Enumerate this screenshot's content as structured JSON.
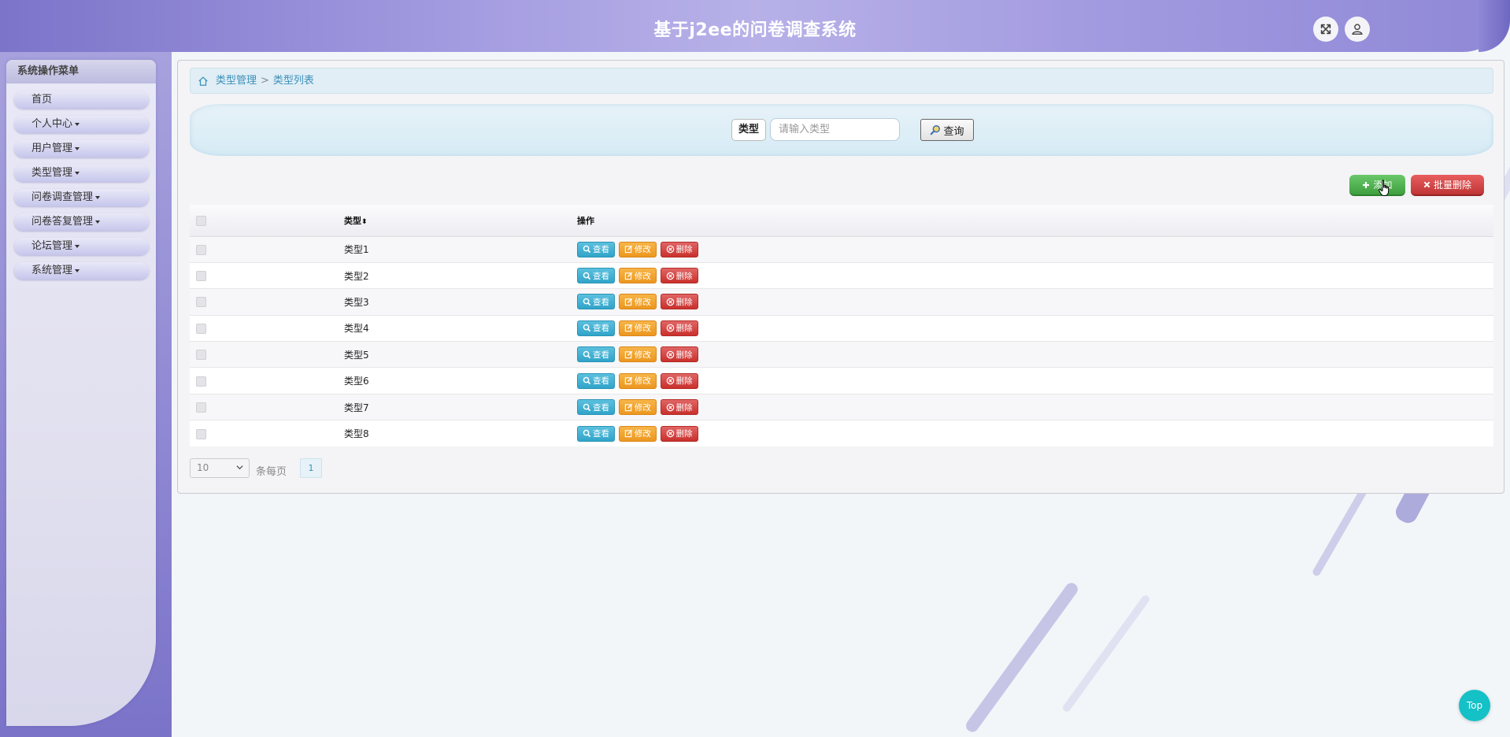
{
  "header": {
    "title": "基于j2ee的问卷调查系统"
  },
  "sidebar": {
    "title": "系统操作菜单",
    "items": [
      {
        "label": "首页",
        "dropdown": false
      },
      {
        "label": "个人中心",
        "dropdown": true
      },
      {
        "label": "用户管理",
        "dropdown": true
      },
      {
        "label": "类型管理",
        "dropdown": true
      },
      {
        "label": "问卷调查管理",
        "dropdown": true
      },
      {
        "label": "问卷答复管理",
        "dropdown": true
      },
      {
        "label": "论坛管理",
        "dropdown": true
      },
      {
        "label": "系统管理",
        "dropdown": true
      }
    ]
  },
  "breadcrumb": {
    "parent": "类型管理",
    "separator": ">",
    "current": "类型列表"
  },
  "search": {
    "label": "类型",
    "placeholder": "请输入类型",
    "value": "",
    "button": "查询"
  },
  "actions": {
    "add": "添加",
    "batch_delete": "批量删除"
  },
  "table": {
    "columns": {
      "type": "类型",
      "operation": "操作"
    },
    "buttons": {
      "view": "查看",
      "edit": "修改",
      "delete": "删除"
    },
    "rows": [
      "类型1",
      "类型2",
      "类型3",
      "类型4",
      "类型5",
      "类型6",
      "类型7",
      "类型8"
    ]
  },
  "pagination": {
    "page_size": "10",
    "per_page_label": "条每页",
    "current_page": "1"
  },
  "top_button": "Top",
  "colors": {
    "header": "#a39be0",
    "sidebar": "#e1e0ef",
    "view_button": "#5bc0de",
    "edit_button": "#f0a030",
    "delete_button": "#d9534f",
    "add_button": "#4cae4c",
    "top_button": "#14c1c6"
  },
  "icons": {
    "fullscreen": "fullscreen-icon",
    "user": "user-icon",
    "home": "home-icon",
    "search": "search-icon",
    "add": "plus-icon",
    "batch_delete": "x-icon",
    "view": "magnifier-icon",
    "edit": "pencil-icon",
    "delete": "circle-x-icon",
    "sort": "sort-icon"
  }
}
